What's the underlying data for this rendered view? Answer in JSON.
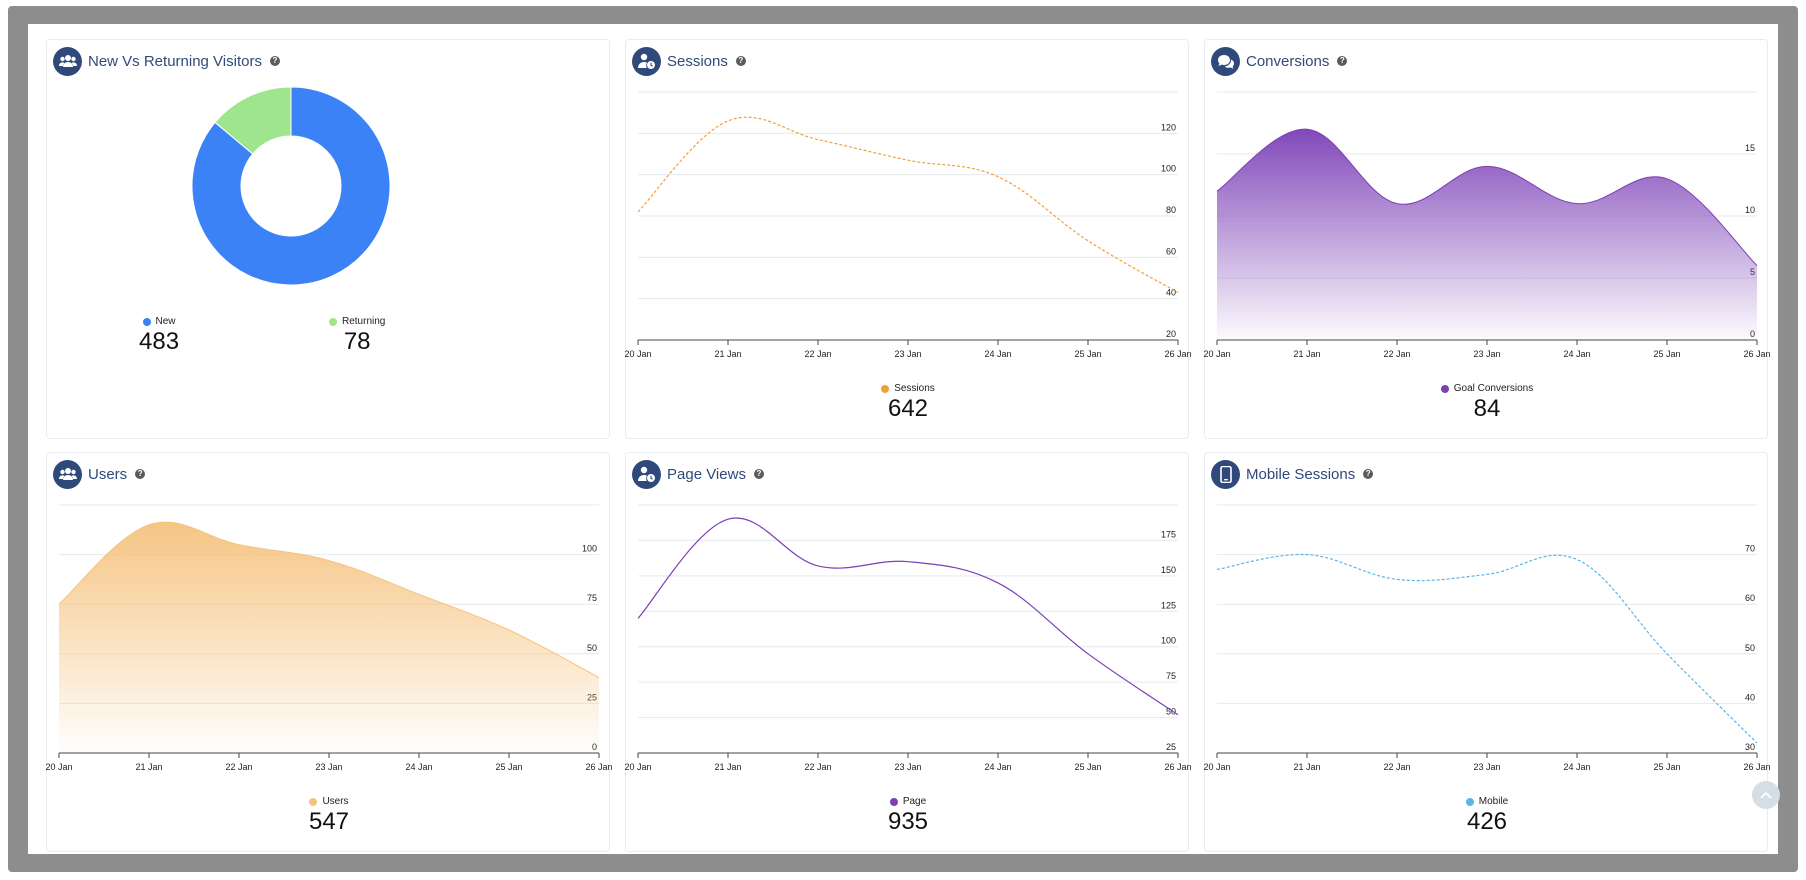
{
  "cards": {
    "visitors": {
      "title": "New Vs Returning Visitors",
      "icon": "users-icon",
      "legend": [
        {
          "label": "New",
          "value": "483",
          "color": "#3b82f6"
        },
        {
          "label": "Returning",
          "value": "78",
          "color": "#9ee58e"
        }
      ]
    },
    "sessions": {
      "title": "Sessions",
      "icon": "user-clock-icon",
      "legend_label": "Sessions",
      "value": "642",
      "color": "#f0a03c"
    },
    "conversions": {
      "title": "Conversions",
      "icon": "chat-icon",
      "legend_label": "Goal Conversions",
      "value": "84",
      "color": "#7b3fb6"
    },
    "users": {
      "title": "Users",
      "icon": "users-icon",
      "legend_label": "Users",
      "value": "547",
      "color": "#f5c27d"
    },
    "pageviews": {
      "title": "Page Views",
      "icon": "user-clock-icon",
      "legend_label": "Page",
      "value": "935",
      "color": "#7b3fb6"
    },
    "mobile": {
      "title": "Mobile Sessions",
      "icon": "mobile-icon",
      "legend_label": "Mobile",
      "value": "426",
      "color": "#5ab4e5"
    }
  },
  "chart_data": [
    {
      "id": "visitors",
      "type": "pie",
      "categories": [
        "New",
        "Returning"
      ],
      "values": [
        483,
        78
      ],
      "colors": [
        "#3b82f6",
        "#9ee58e"
      ]
    },
    {
      "id": "sessions",
      "type": "line",
      "style": "dashed",
      "categories": [
        "20 Jan",
        "21 Jan",
        "22 Jan",
        "23 Jan",
        "24 Jan",
        "25 Jan",
        "26 Jan"
      ],
      "series": [
        {
          "name": "Sessions",
          "values": [
            82,
            126,
            117,
            107,
            99,
            68,
            43
          ]
        }
      ],
      "ylim": [
        20,
        140
      ],
      "yticks": [
        20,
        40,
        60,
        80,
        100,
        120
      ],
      "color": "#f0a03c"
    },
    {
      "id": "conversions",
      "type": "area",
      "categories": [
        "20 Jan",
        "21 Jan",
        "22 Jan",
        "23 Jan",
        "24 Jan",
        "25 Jan",
        "26 Jan"
      ],
      "series": [
        {
          "name": "Goal Conversions",
          "values": [
            12,
            17,
            11,
            14,
            11,
            13,
            6
          ]
        }
      ],
      "ylim": [
        0,
        20
      ],
      "yticks": [
        0,
        5,
        10,
        15
      ],
      "color": "#7b3fb6"
    },
    {
      "id": "users",
      "type": "area",
      "categories": [
        "20 Jan",
        "21 Jan",
        "22 Jan",
        "23 Jan",
        "24 Jan",
        "25 Jan",
        "26 Jan"
      ],
      "series": [
        {
          "name": "Users",
          "values": [
            75,
            115,
            105,
            97,
            80,
            62,
            38
          ]
        }
      ],
      "ylim": [
        0,
        125
      ],
      "yticks": [
        0,
        25,
        50,
        75,
        100
      ],
      "color": "#f5c27d"
    },
    {
      "id": "pageviews",
      "type": "line",
      "categories": [
        "20 Jan",
        "21 Jan",
        "22 Jan",
        "23 Jan",
        "24 Jan",
        "25 Jan",
        "26 Jan"
      ],
      "series": [
        {
          "name": "Page",
          "values": [
            120,
            190,
            157,
            160,
            145,
            95,
            52
          ]
        }
      ],
      "ylim": [
        25,
        200
      ],
      "yticks": [
        25,
        50,
        75,
        100,
        125,
        150,
        175
      ],
      "color": "#7b3fb6"
    },
    {
      "id": "mobile",
      "type": "line",
      "style": "dashed",
      "categories": [
        "20 Jan",
        "21 Jan",
        "22 Jan",
        "23 Jan",
        "24 Jan",
        "25 Jan",
        "26 Jan"
      ],
      "series": [
        {
          "name": "Mobile",
          "values": [
            67,
            70,
            65,
            66,
            69,
            50,
            32
          ]
        }
      ],
      "ylim": [
        30,
        80
      ],
      "yticks": [
        30,
        40,
        50,
        60,
        70
      ],
      "color": "#5ab4e5"
    }
  ]
}
